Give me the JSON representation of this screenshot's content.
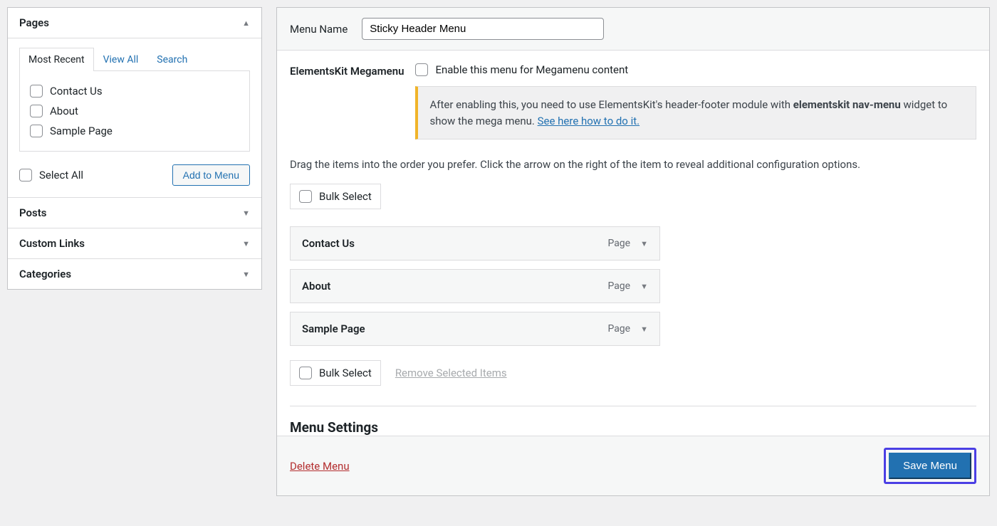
{
  "sidebar": {
    "pages": {
      "title": "Pages",
      "tabs": [
        "Most Recent",
        "View All",
        "Search"
      ],
      "items": [
        {
          "label": "Contact Us"
        },
        {
          "label": "About"
        },
        {
          "label": "Sample Page"
        }
      ],
      "select_all": "Select All",
      "add_button": "Add to Menu"
    },
    "posts": {
      "title": "Posts"
    },
    "custom_links": {
      "title": "Custom Links"
    },
    "categories": {
      "title": "Categories"
    }
  },
  "menu": {
    "name_label": "Menu Name",
    "name_value": "Sticky Header Menu",
    "megamenu": {
      "label": "ElementsKit Megamenu",
      "enable_text": "Enable this menu for Megamenu content",
      "notice_pre": "After enabling this, you need to use ElementsKit's header-footer module with ",
      "notice_bold": "elementskit nav-menu",
      "notice_post": " widget to show the mega menu. ",
      "notice_link": "See here how to do it."
    },
    "instructions": "Drag the items into the order you prefer. Click the arrow on the right of the item to reveal additional configuration options.",
    "bulk_select": "Bulk Select",
    "items": [
      {
        "title": "Contact Us",
        "type": "Page"
      },
      {
        "title": "About",
        "type": "Page"
      },
      {
        "title": "Sample Page",
        "type": "Page"
      }
    ],
    "remove_selected": "Remove Selected Items",
    "settings_heading": "Menu Settings",
    "delete": "Delete Menu",
    "save": "Save Menu"
  }
}
